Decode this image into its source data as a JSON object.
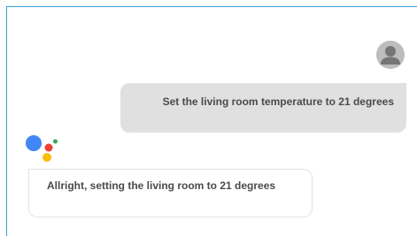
{
  "conversation": {
    "user_message": "Set the living room temperature to 21 degrees",
    "assistant_message": "Allright, setting the living room to 21 degrees"
  },
  "icons": {
    "user_avatar": "user-avatar-icon",
    "assistant_logo": "google-assistant-icon"
  },
  "colors": {
    "frame_border": "#3aa0d8",
    "user_bubble": "#e0e0e0",
    "avatar_bg": "#bdbdbd",
    "assistant_blue": "#4285f4",
    "assistant_red": "#ea4335",
    "assistant_yellow": "#fbbc05",
    "assistant_green": "#34a853"
  }
}
